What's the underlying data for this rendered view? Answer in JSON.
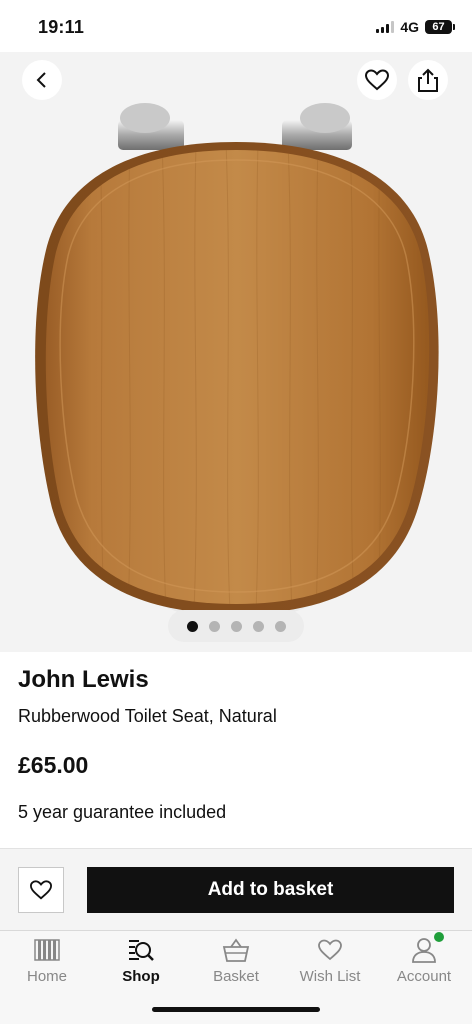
{
  "status_bar": {
    "time": "19:11",
    "network": "4G",
    "battery": "67"
  },
  "gallery": {
    "image_count": 5,
    "active_index": 0
  },
  "product": {
    "brand": "John Lewis",
    "name": "Rubberwood Toilet Seat, Natural",
    "price": "£65.00",
    "guarantee": "5 year guarantee included"
  },
  "purchase": {
    "add_to_basket_label": "Add to basket"
  },
  "icons": {
    "back": "chevron-left-icon",
    "wishlist": "heart-icon",
    "share": "share-icon"
  },
  "tabs": [
    {
      "label": "Home",
      "icon": "home-icon",
      "active": false
    },
    {
      "label": "Shop",
      "icon": "shop-search-icon",
      "active": true
    },
    {
      "label": "Basket",
      "icon": "basket-icon",
      "active": false
    },
    {
      "label": "Wish List",
      "icon": "heart-icon",
      "active": false
    },
    {
      "label": "Account",
      "icon": "user-icon",
      "active": false
    }
  ],
  "colors": {
    "primary_button": "#111111",
    "gallery_background": "#f3f3f3",
    "notification_dot": "#1f9e3a"
  }
}
